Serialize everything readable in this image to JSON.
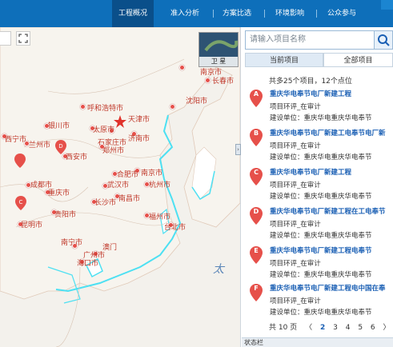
{
  "nav": {
    "tabs": [
      "工程概况",
      "准入分析",
      "方案比选",
      "环境影响",
      "公众参与"
    ],
    "active": 0
  },
  "map": {
    "satellite_label": "卫 星",
    "sea_label": "太",
    "cities": [
      "南京市",
      "长春市",
      "呼和浩特市",
      "沈阳市",
      "天津市",
      "石家庄市",
      "济南市",
      "银川市",
      "太原市",
      "西宁市",
      "兰州市",
      "郑州市",
      "西安市",
      "南京市",
      "合肥市",
      "杭州市",
      "成都市",
      "武汉市",
      "重庆市",
      "南昌市",
      "长沙市",
      "福州市",
      "贵阳市",
      "台北市",
      "昆明市",
      "南宁市",
      "广州市",
      "澳门",
      "海口市"
    ]
  },
  "panel": {
    "search_placeholder": "请输入项目名称",
    "tab_current": "当前项目",
    "tab_all": "全部项目",
    "summary": "共多25个项目，12个点位",
    "items": [
      {
        "marker": "A",
        "title": "重庆华电奉节电厂新建工程",
        "status": "项目环评_在审计",
        "unit": "建设单位：重庆华电重庆华电奉节"
      },
      {
        "marker": "B",
        "title": "重庆华电奉节电厂新建工电奉节电厂新",
        "status": "项目环评_在审计",
        "unit": "建设单位：重庆华电重庆华电奉节"
      },
      {
        "marker": "C",
        "title": "重庆华电奉节电厂新建工程",
        "status": "项目环评_在审计",
        "unit": "建设单位：重庆华电重庆华电奉节"
      },
      {
        "marker": "D",
        "title": "重庆华电奉节电厂新建工程在工电奉节",
        "status": "项目环评_在审计",
        "unit": "建设单位：重庆华电重庆华电奉节"
      },
      {
        "marker": "E",
        "title": "重庆华电奉节电厂新建工程电奉节",
        "status": "项目环评_在审计",
        "unit": "建设单位：重庆华电重庆华电奉节"
      },
      {
        "marker": "F",
        "title": "重庆华电奉节电厂新建工程电中国在奉",
        "status": "项目环评_在审计",
        "unit": "建设单位：重庆华电重庆华电奉节"
      }
    ],
    "pager": {
      "per_page": "共 10 页",
      "prev": "〈",
      "pages": [
        "2",
        "3",
        "4",
        "5",
        "6"
      ],
      "next": "〉"
    },
    "status_bar": "状态栏"
  },
  "colors": {
    "nav": "#0e6fba",
    "accent": "#1a5fb4",
    "marker": "#e6504a",
    "coast": "#4de0f2"
  }
}
